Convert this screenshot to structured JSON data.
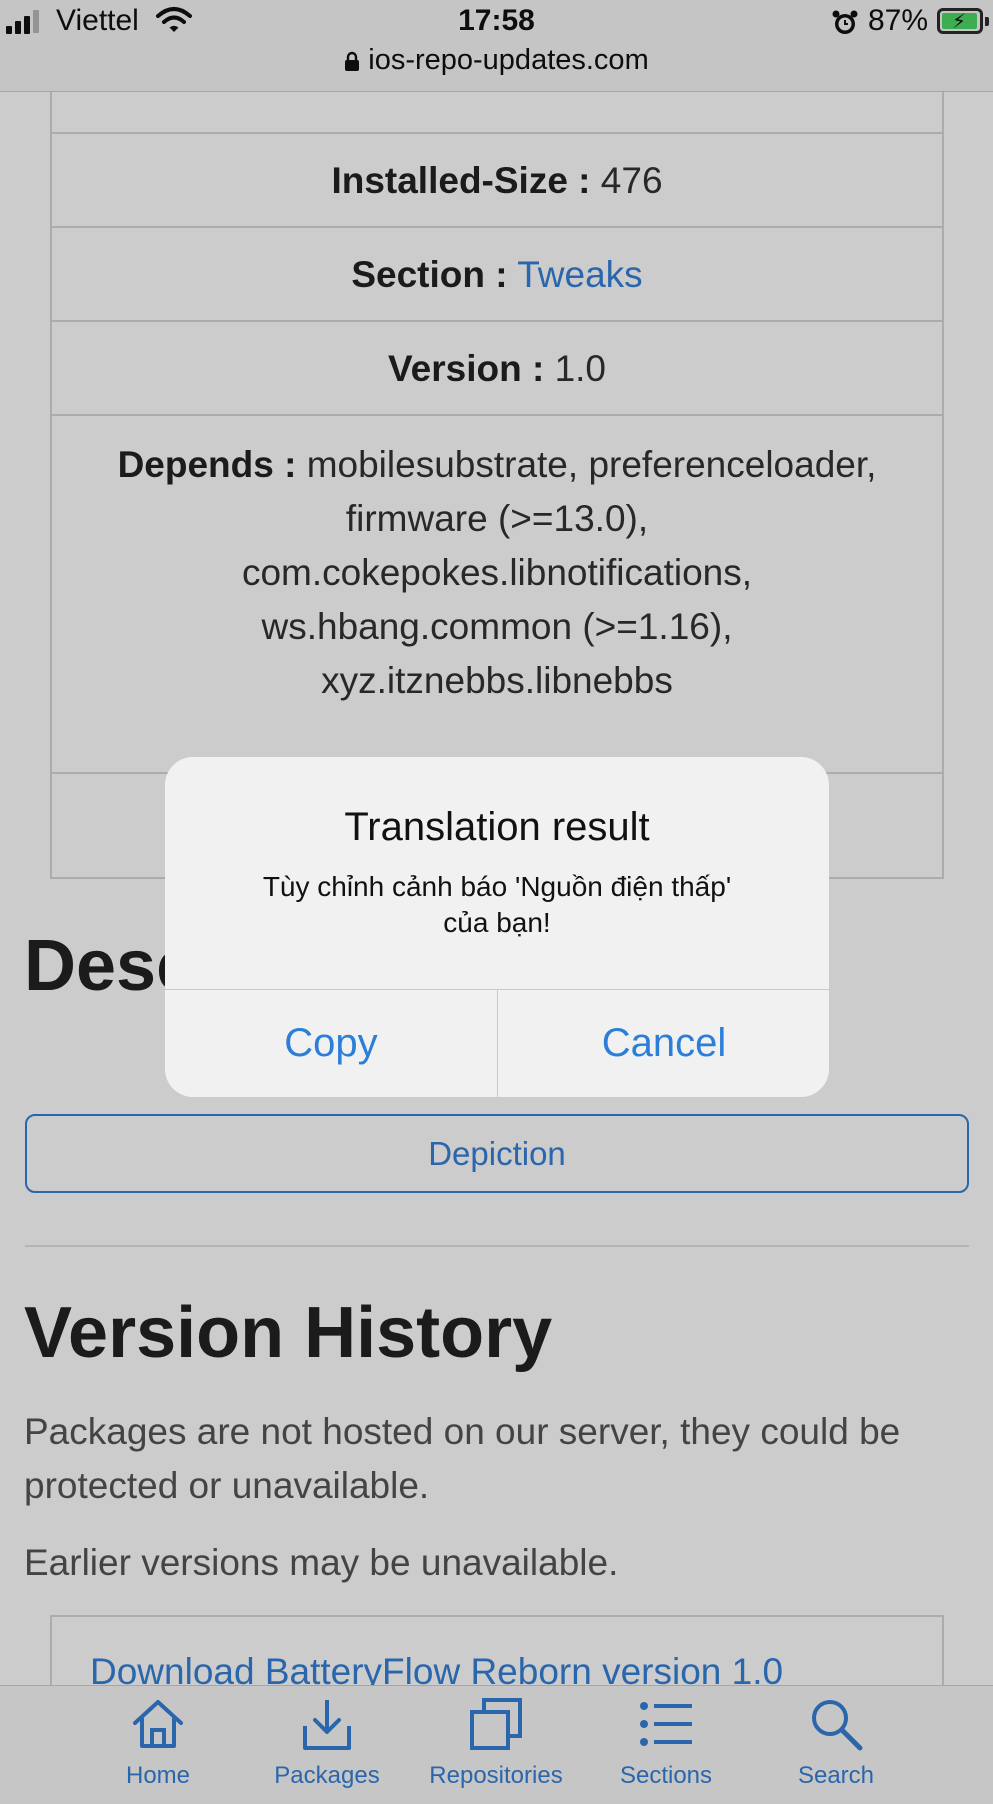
{
  "status_bar": {
    "carrier": "Viettel",
    "time": "17:58",
    "battery": "87%",
    "battery_level": 0.87,
    "url": "ios-repo-updates.com"
  },
  "details": {
    "installed_size": {
      "key": "Installed-Size :",
      "value": "476"
    },
    "section": {
      "key": "Section :",
      "value": "Tweaks"
    },
    "version": {
      "key": "Version :",
      "value": "1.0"
    },
    "depends": {
      "key": "Depends :",
      "line1": "mobilesubstrate, preferenceloader,",
      "line2": "firmware (>=13.0),",
      "line3": "com.cokepokes.libnotifications,",
      "line4": "ws.hbang.common (>=1.16),",
      "line5": "xyz.itznebbs.libnebbs"
    }
  },
  "description": {
    "title": "Desc",
    "depiction_button": "Depiction"
  },
  "version_history": {
    "title": "Version History",
    "note1": "Packages are not hosted on our server, they could be protected or unavailable.",
    "note2": "Earlier versions may be unavailable.",
    "download_link": "Download BatteryFlow Reborn version 1.0"
  },
  "alert": {
    "title": "Translation result",
    "message_line1": "Tùy chỉnh cảnh báo 'Nguồn điện thấp'",
    "message_line2": "của bạn!",
    "copy_label": "Copy",
    "cancel_label": "Cancel"
  },
  "tabs": [
    {
      "label": "Home",
      "icon": "home-icon"
    },
    {
      "label": "Packages",
      "icon": "download-tray-icon"
    },
    {
      "label": "Repositories",
      "icon": "stacked-squares-icon"
    },
    {
      "label": "Sections",
      "icon": "list-icon"
    },
    {
      "label": "Search",
      "icon": "search-icon"
    }
  ],
  "colors": {
    "link": "#3580d8",
    "battery_fill": "#4cd964"
  }
}
